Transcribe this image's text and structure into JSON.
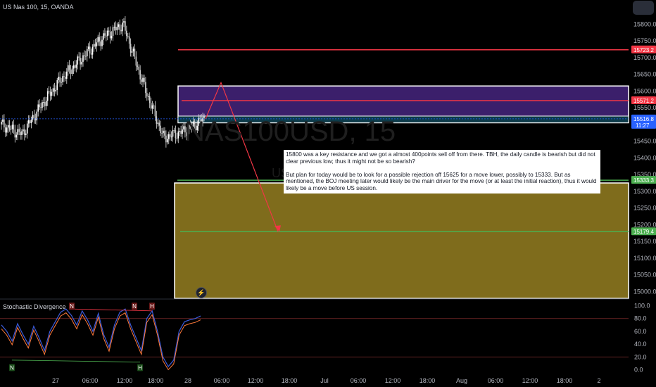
{
  "header": {
    "title": "US Nas 100, 15, OANDA"
  },
  "watermark": {
    "main": "NAS100USD, 15",
    "sub": "US"
  },
  "indicator": {
    "title": "Stochastic Divergence"
  },
  "note": {
    "text": "15800 was a key resistance and we got a almost 400points sell off from there. TBH, the daily candle is bearish but did not clear previous low; thus it might not be so bearish?\n\nBut plan for today would be to look for a possible rejection off 15625 for a move lower, possibly to 15333. But as mentioned, the BOJ meeting later would likely be the main driver for the move (or at least the initial reaction), thus it would likely be a move before US session."
  },
  "price_tags": [
    {
      "label": "15723.2",
      "price": 15723.2,
      "color": "#f23645"
    },
    {
      "label": "15571.2",
      "price": 15571.2,
      "color": "#f23645"
    },
    {
      "label": "15516.8",
      "price": 15516.8,
      "color": "#2962ff",
      "sub": "11:27"
    },
    {
      "label": "15333.3",
      "price": 15333.3,
      "color": "#4caf50"
    },
    {
      "label": "15179.4",
      "price": 15179.4,
      "color": "#4caf50"
    }
  ],
  "colors": {
    "bull": "#ffffff",
    "bear": "#ffffff",
    "purple_zone": "#3b1f6b",
    "olive_zone": "#7f6c1c",
    "red_line": "#f23645",
    "green_line": "#4caf50"
  },
  "chart_data": [
    {
      "type": "candlestick",
      "title": "US Nas 100, 15, OANDA",
      "y_ticks": [
        "15800.0",
        "15750.0",
        "15700.0",
        "15650.0",
        "15600.0",
        "15550.0",
        "15500.0",
        "15450.0",
        "15400.0",
        "15350.0",
        "15300.0",
        "15250.0",
        "15200.0",
        "15150.0",
        "15100.0",
        "15050.0",
        "15000.0"
      ],
      "ylim": [
        14980,
        15830
      ],
      "x_ticks": [
        "27",
        "06:00",
        "12:00",
        "18:00",
        "28",
        "06:00",
        "12:00",
        "18:00",
        "Jul",
        "06:00",
        "12:00",
        "18:00",
        "Aug",
        "06:00",
        "12:00",
        "18:00",
        "2",
        "06:00"
      ],
      "horizontal_levels": [
        15723.2,
        15571.2,
        15333.3,
        15179.4
      ],
      "zones": [
        {
          "name": "resistance",
          "from": 15505,
          "to": 15615
        },
        {
          "name": "target",
          "from": 14980,
          "to": 15325
        }
      ],
      "last_price": 15516.8,
      "path_key_prices": [
        15500,
        15470,
        15560,
        15640,
        15700,
        15760,
        15800,
        15620,
        15460,
        15480,
        15516.8
      ],
      "projection": [
        15516.8,
        15625,
        15179.4
      ]
    },
    {
      "type": "line",
      "title": "Stochastic Divergence",
      "y_ticks": [
        "100.0",
        "80.0",
        "60.0",
        "40.0",
        "20.0",
        "0.0"
      ],
      "ylim": [
        -5,
        105
      ],
      "levels": [
        80,
        20
      ],
      "series": [
        {
          "values": [
            70,
            60,
            45,
            72,
            55,
            40,
            68,
            50,
            30,
            60,
            75,
            90,
            95,
            85,
            70,
            92,
            78,
            60,
            88,
            55,
            35,
            70,
            90,
            95,
            70,
            50,
            30,
            80,
            92,
            60,
            20,
            5,
            15,
            60,
            75,
            78,
            80,
            84
          ]
        }
      ],
      "markers": [
        "N",
        "N",
        "H",
        "N",
        "H"
      ]
    }
  ]
}
